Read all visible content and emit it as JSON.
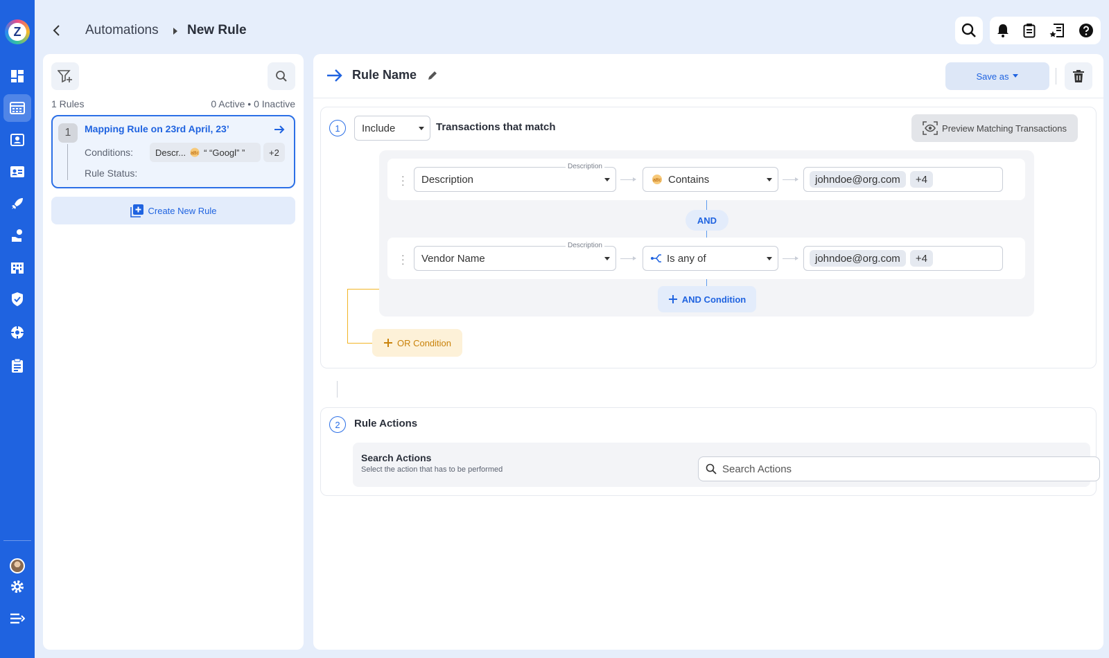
{
  "sidebar": {
    "logo_letter": "Z",
    "items": [
      {
        "icon": "dashboard-icon"
      },
      {
        "icon": "calendar-grid-icon"
      },
      {
        "icon": "contacts-icon"
      },
      {
        "icon": "id-card-icon"
      },
      {
        "icon": "rocket-icon"
      },
      {
        "icon": "hand-coin-icon"
      },
      {
        "icon": "building-icon"
      },
      {
        "icon": "shield-check-icon"
      },
      {
        "icon": "network-icon"
      },
      {
        "icon": "clipboard-icon"
      }
    ],
    "bottom": [
      {
        "icon": "avatar"
      },
      {
        "icon": "gear-icon"
      },
      {
        "icon": "collapse-menu-icon"
      }
    ]
  },
  "header": {
    "crumb_parent": "Automations",
    "crumb_current": "New Rule",
    "actions": [
      "search-icon",
      "bell-icon",
      "clipboard-icon",
      "receipt-star-icon",
      "help-icon"
    ]
  },
  "rules_panel": {
    "rules_count": "1 Rules",
    "status_summary": "0 Active • 0 Inactive",
    "rule": {
      "number": "1",
      "title": "Mapping Rule on 23rd April, 23’",
      "conditions_label": "Conditions:",
      "condition_field": "Descr...",
      "condition_value": "“ “Googl” ”",
      "more": "+2",
      "status_label": "Rule Status:"
    },
    "create_label": "Create New Rule"
  },
  "editor": {
    "rule_name": "Rule Name",
    "save_label": "Save as",
    "section1": {
      "step": "1",
      "include": "Include",
      "heading": "Transactions that match",
      "preview_label": "Preview Matching Transactions",
      "conditions": [
        {
          "field": "Description",
          "field_label": "Description",
          "operator": "Contains",
          "value": "johndoe@org.com",
          "more": "+4"
        },
        {
          "field": "Vendor Name",
          "field_label": "Description",
          "operator": "Is any of",
          "value": "johndoe@org.com",
          "more": "+4"
        }
      ],
      "and_label": "AND",
      "and_condition_label": "AND Condition",
      "or_condition_label": "OR Condition"
    },
    "section2": {
      "step": "2",
      "heading": "Rule Actions",
      "search_title": "Search Actions",
      "search_subtitle": "Select the action that has to be performed",
      "search_placeholder": "Search Actions"
    }
  },
  "colors": {
    "primary": "#1f63e0",
    "background": "#e6eefb",
    "or_accent": "#f2b526"
  }
}
